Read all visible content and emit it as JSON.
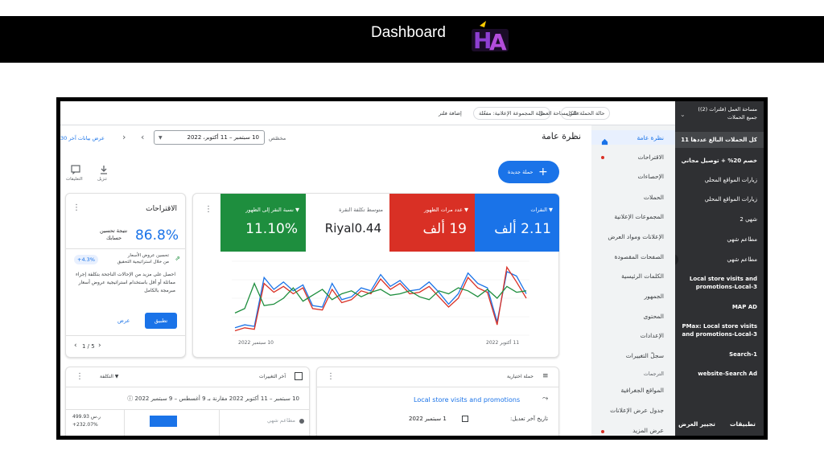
{
  "banner": {
    "title": "Dashboard",
    "logo_text": "HA"
  },
  "sidebar": {
    "header_line1": "مساحة العمل (فلترات (2))",
    "header_line2": "جميع الحملات",
    "items": [
      {
        "label": "كل الحملات البالغ عددها 11"
      },
      {
        "label": "خصم 20% + توصيل مجاني"
      },
      {
        "label": "زيارات المواقع المحلي"
      },
      {
        "label": "زيارات المواقع المحلي"
      },
      {
        "label": "شهي 2"
      },
      {
        "label": "مطاعم شهي"
      },
      {
        "label": "مطاعم شهي"
      },
      {
        "label": "Local store visits and"
      },
      {
        "label": "promotions-Local-3"
      },
      {
        "label": "MAP AD"
      },
      {
        "label": "PMax: Local store visits"
      },
      {
        "label": "and promotions-Local-3"
      },
      {
        "label": "Search-1"
      },
      {
        "label": "website-Search Ad"
      }
    ],
    "footer_left": "تطبيقات",
    "footer_right": "تجيير العرض"
  },
  "nav": {
    "items": [
      "نظرة عامة",
      "الاقتراحات",
      "الإحصاءات",
      "الحملات",
      "المجموعات الإعلانية",
      "الإعلانات ومواد العرض",
      "الصفحات المقصودة",
      "الكلمات الرئيسية",
      "الجمهور",
      "المحتوى",
      "الإعدادات",
      "سجلّ التغييرات",
      "الترجمات",
      "المواقع الجغرافية",
      "جدول عرض الإعلانات",
      "عرض المزيد"
    ]
  },
  "topbar": {
    "filter_workspace": "فلتر مساحة العمل",
    "chip_campaign": "حالة الحملة: الكل",
    "chip_adgroup": "حالة المجموعة الإعلانية: مفعّلة",
    "add_filter": "إضافة فلتر"
  },
  "header": {
    "title": "نظرة عامة",
    "date_label": "مخصّص",
    "date_range": "10 سبتمبر – 11 أكتوبر، 2022",
    "recent_data": "عرض بيانات آخر 30",
    "new_campaign": "حملة جديدة",
    "download": "تنزيل",
    "feedback": "التعليقات"
  },
  "metrics": [
    {
      "label": "النقرات",
      "value": "2.11 ألف",
      "color": "#1a73e8"
    },
    {
      "label": "عدد مرات الظهور",
      "value": "19 ألف",
      "color": "#d93025"
    },
    {
      "label": "متوسط تكلفة النقرة",
      "value": "Riyal0.44",
      "color": "#ffffff"
    },
    {
      "label": "نسبة النقر إلى الظهور",
      "value": "11.10%",
      "color": "#1e8e3e"
    }
  ],
  "chart_data": {
    "type": "line",
    "x_start": "10 سبتمبر 2022",
    "x_end": "11 أكتوبر 2022",
    "series": [
      {
        "color": "#1a73e8",
        "values": [
          10,
          14,
          12,
          78,
          62,
          72,
          60,
          68,
          40,
          38,
          70,
          48,
          52,
          64,
          60,
          82,
          66,
          74,
          60,
          62,
          72,
          58,
          42,
          56,
          84,
          70,
          64,
          18,
          86,
          80,
          56
        ]
      },
      {
        "color": "#d93025",
        "values": [
          6,
          10,
          8,
          70,
          58,
          66,
          56,
          64,
          36,
          34,
          62,
          44,
          48,
          60,
          56,
          76,
          62,
          70,
          56,
          58,
          66,
          52,
          38,
          50,
          78,
          64,
          58,
          14,
          92,
          72,
          50
        ]
      },
      {
        "color": "#1e8e3e",
        "values": [
          30,
          36,
          70,
          40,
          42,
          50,
          64,
          46,
          54,
          62,
          48,
          56,
          60,
          52,
          58,
          62,
          54,
          56,
          60,
          52,
          48,
          60,
          56,
          64,
          60,
          52,
          62,
          50,
          66,
          58,
          60
        ]
      }
    ],
    "tick_left": "10 سبتمبر 2022",
    "tick_right": "11 أكتوبر 2022"
  },
  "suggestions": {
    "title": "الاقتراحات",
    "score": "86.8%",
    "score_label": "نتيجة تحسين",
    "score_sub": "حسابك",
    "tip_title": "تحسين عروض الأسعار",
    "tip_sub": "من خلال استراتيجية التحقيق",
    "tip_badge": "+4.3%",
    "body": "احصل على مزيد من الإحالات الناجحة بتكلفة إجراء مماثلة أو أقل باستخدام استراتيجية عروض أسعار مبرمجة بالكامل",
    "apply": "تطبيق",
    "view": "عرض",
    "pager": "1 / 5"
  },
  "bottom_left": {
    "title": "آخر التغييرات",
    "cost_label": "التكلفة",
    "range": "10 سبتمبر – 11 أكتوبر 2022 مقارنة بـ 9 أغسطس – 9 سبتمبر 2022",
    "row_name": "مطاعم شهي",
    "row_value": "499.93 ر.س",
    "row_change": "+232.07%"
  },
  "bottom_right": {
    "title": "حملة اختيارية",
    "campaign": "Local store visits and promotions",
    "last_edit_label": "تاريخ آخر تعديل:",
    "last_edit_value": "1 سبتمبر 2022"
  }
}
